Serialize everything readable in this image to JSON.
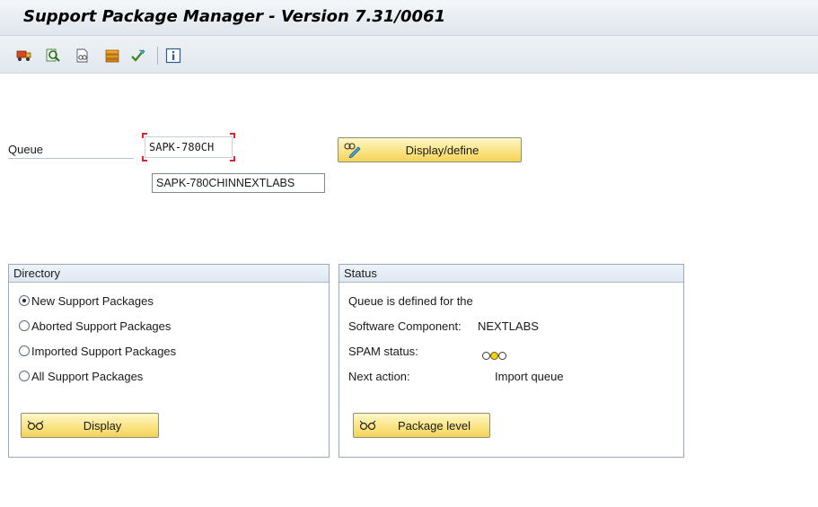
{
  "window": {
    "title": "Support Package Manager - Version 7.31/0061"
  },
  "toolbar": {
    "buttons": [
      {
        "name": "transport-icon",
        "tooltip": ""
      },
      {
        "name": "find-icon",
        "tooltip": ""
      },
      {
        "name": "document-display-icon",
        "tooltip": ""
      },
      {
        "name": "package-icon",
        "tooltip": ""
      },
      {
        "name": "check-icon",
        "tooltip": ""
      },
      {
        "name": "info-icon",
        "tooltip": ""
      }
    ]
  },
  "queue": {
    "label": "Queue",
    "value": "SAPK-780CH",
    "suggestion": "SAPK-780CHINNEXTLABS",
    "display_define_label": "Display/define"
  },
  "directory": {
    "title": "Directory",
    "options": [
      {
        "label": "New Support Packages",
        "checked": true
      },
      {
        "label": "Aborted Support Packages",
        "checked": false
      },
      {
        "label": "Imported Support Packages",
        "checked": false
      },
      {
        "label": "All Support Packages",
        "checked": false
      }
    ],
    "display_label": "Display"
  },
  "status": {
    "title": "Status",
    "line1": "Queue is defined for the",
    "software_component_label": "Software Component:",
    "software_component_value": "NEXTLABS",
    "spam_status_label": "SPAM status:",
    "spam_status_lights": [
      "off",
      "yellow",
      "off"
    ],
    "next_action_label": "Next action:",
    "next_action_value": "Import queue",
    "package_level_label": "Package level"
  },
  "colors": {
    "button_yellow": "#f9e27f",
    "group_border": "#97a8bf",
    "focus_red": "#d7262d"
  }
}
